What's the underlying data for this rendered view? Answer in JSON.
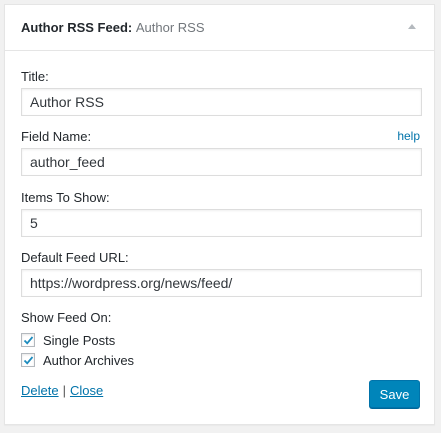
{
  "widget": {
    "title": "Author RSS Feed:",
    "subtitle": "Author RSS",
    "toggle_icon": "arrow-up-icon"
  },
  "fields": {
    "title": {
      "label": "Title:",
      "value": "Author RSS"
    },
    "field_name": {
      "label": "Field Name:",
      "value": "author_feed",
      "help": "help"
    },
    "items": {
      "label": "Items To Show:",
      "value": "5"
    },
    "feed_url": {
      "label": "Default Feed URL:",
      "value": "https://wordpress.org/news/feed/"
    }
  },
  "show_feed": {
    "label": "Show Feed On:",
    "options": [
      {
        "label": "Single Posts",
        "checked": true
      },
      {
        "label": "Author Archives",
        "checked": true
      }
    ]
  },
  "actions": {
    "delete_label": "Delete",
    "separator": "|",
    "close_label": "Close",
    "save_label": "Save"
  },
  "colors": {
    "accent": "#0085ba",
    "link": "#0073aa"
  }
}
